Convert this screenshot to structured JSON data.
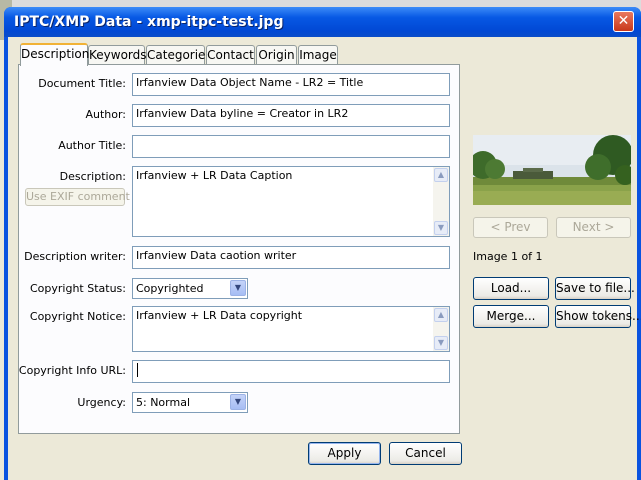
{
  "dialog": {
    "title": "IPTC/XMP Data - xmp-itpc-test.jpg",
    "close_symbol": "✕"
  },
  "tabs": [
    {
      "label": "Description",
      "active": true
    },
    {
      "label": "Keywords",
      "active": false
    },
    {
      "label": "Categories",
      "active": false
    },
    {
      "label": "Contact",
      "active": false
    },
    {
      "label": "Origin",
      "active": false
    },
    {
      "label": "Image",
      "active": false
    }
  ],
  "form": {
    "document_title": {
      "label": "Document Title:",
      "value": "Irfanview Data Object Name - LR2 = Title"
    },
    "author": {
      "label": "Author:",
      "value": "Irfanview Data byline = Creator in LR2"
    },
    "author_title": {
      "label": "Author Title:",
      "value": ""
    },
    "description": {
      "label": "Description:",
      "value": "Irfanview + LR Data Caption"
    },
    "use_exif_button": "Use EXIF comment",
    "description_writer": {
      "label": "Description writer:",
      "value": "Irfanview Data caotion writer"
    },
    "copyright_status": {
      "label": "Copyright Status:",
      "value": "Copyrighted"
    },
    "copyright_notice": {
      "label": "Copyright Notice:",
      "value": "Irfanview + LR Data copyright"
    },
    "copyright_url": {
      "label": "Copyright Info URL:",
      "value": ""
    },
    "urgency": {
      "label": "Urgency:",
      "value": "5: Normal"
    }
  },
  "side": {
    "prev_button": "< Prev",
    "next_button": "Next >",
    "image_counter": "Image 1 of 1",
    "load_button": "Load...",
    "save_button": "Save to file...",
    "merge_button": "Merge...",
    "show_tokens_button": "Show tokens..."
  },
  "footer": {
    "apply_button": "Apply",
    "cancel_button": "Cancel"
  },
  "colors": {
    "titlebar": "#0148d4",
    "dialog_bg": "#ece9d8",
    "active_tab_accent": "#f1b236"
  },
  "icons": {
    "close": "close-icon",
    "dropdown": "chevron-down-icon",
    "scroll_up": "scroll-up-arrow-icon",
    "scroll_down": "scroll-down-arrow-icon"
  }
}
